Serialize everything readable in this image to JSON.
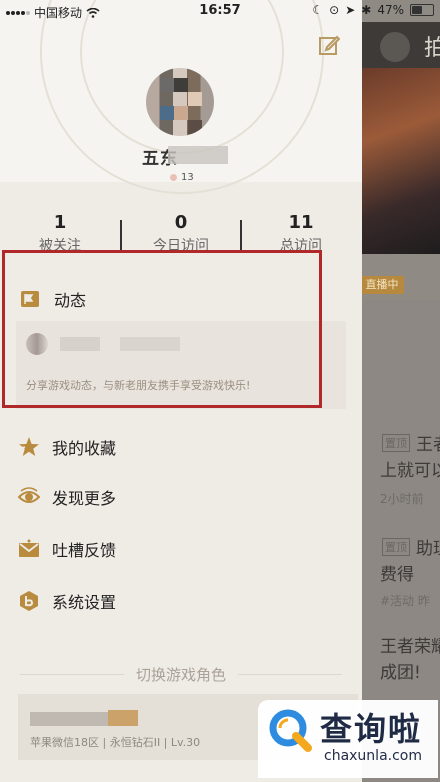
{
  "status_bar": {
    "carrier": "中国移动",
    "time": "16:57",
    "battery_percent": "47%",
    "battery_level": 0.47
  },
  "background_app": {
    "header_title_partial": "拍",
    "live_badge": "直播中",
    "feed_lines": [
      {
        "tag": "置顶",
        "text": "王者"
      },
      {
        "text": "上就可以"
      },
      {
        "small": "2小时前"
      },
      {
        "tag": "置顶",
        "text": "助理"
      },
      {
        "text": "费得"
      },
      {
        "small": "#活动  昨"
      },
      {
        "text": "王者荣耀"
      },
      {
        "text": "成团!"
      }
    ]
  },
  "profile": {
    "nickname_prefix": "五东",
    "level": "13"
  },
  "stats": [
    {
      "value": "1",
      "label": "被关注"
    },
    {
      "value": "0",
      "label": "今日访问"
    },
    {
      "value": "11",
      "label": "总访问"
    }
  ],
  "feed": {
    "title": "动态",
    "description": "分享游戏动态，与新老朋友携手享受游戏快乐!"
  },
  "menu": [
    {
      "label": "我的收藏",
      "icon": "star-icon"
    },
    {
      "label": "发现更多",
      "icon": "eye-icon"
    },
    {
      "label": "吐槽反馈",
      "icon": "mail-icon"
    },
    {
      "label": "系统设置",
      "icon": "settings-icon"
    }
  ],
  "switch_role": {
    "title": "切换游戏角色",
    "role_info": "苹果微信18区 | 永恒钻石II | Lv.30"
  },
  "watermark": {
    "text": "查询啦",
    "url": "chaxunla.com"
  },
  "colors": {
    "highlight_border": "#b0282a",
    "accent_gold": "#b7893e",
    "drawer_bg": "#efece6"
  }
}
